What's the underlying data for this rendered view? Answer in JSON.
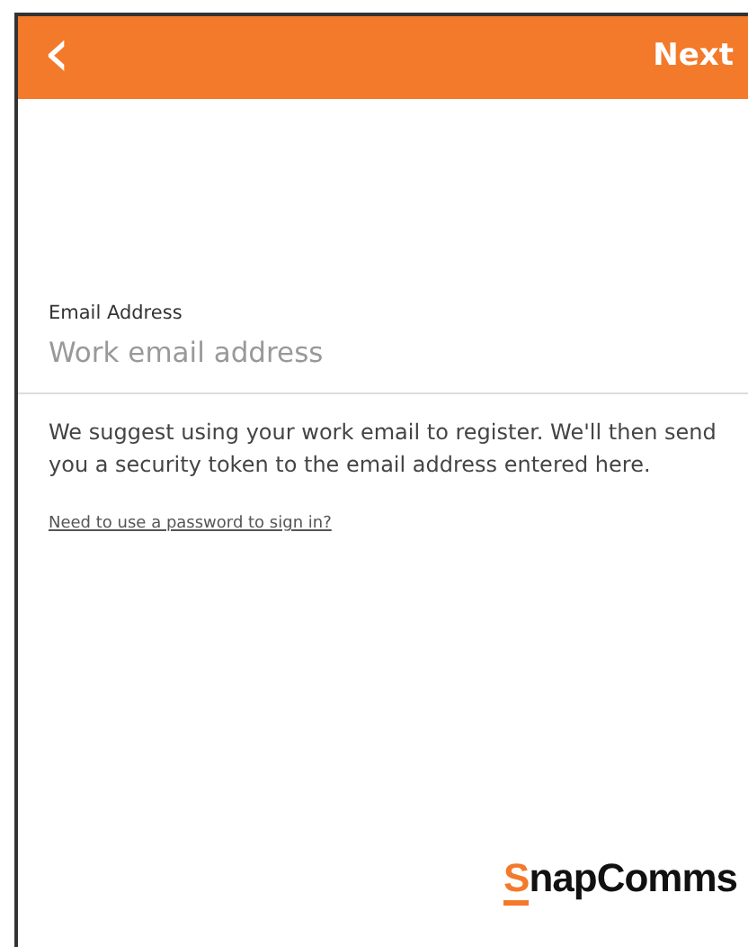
{
  "header": {
    "back": "‹",
    "next": "Next"
  },
  "email_field": {
    "label": "Email Address",
    "placeholder": "Work email address"
  },
  "hint": "We suggest using your work email to register. We'll then send you a security token to the email address entered here.",
  "password_link": "Need to use a password to sign in?",
  "logo": {
    "initial": "S",
    "rest": "napComms"
  }
}
